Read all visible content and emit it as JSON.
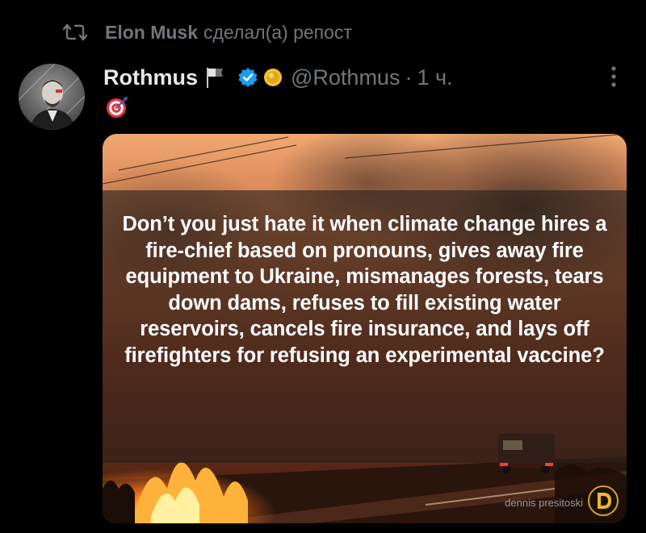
{
  "repost": {
    "name": "Elon Musk",
    "action": "сделал(а) репост"
  },
  "post": {
    "author_name": "Rothmus",
    "handle": "@Rothmus",
    "separator": "·",
    "timestamp": "1 ч.",
    "emoji": "🎯",
    "image_text": "Don’t you just hate it when climate change hires a fire-chief based on pronouns, gives away fire equipment to Ukraine, mismanages forests, tears down dams, refuses to fill existing water reservoirs, cancels fire insurance, and lays off firefighters for refusing an experimental vaccine?",
    "watermark": "dennis presitoski"
  },
  "icons": {
    "repost": "repost-icon",
    "flag": "flag-icon",
    "verified": "verified-badge-icon",
    "coin": "coin-icon",
    "more": "more-vertical-icon",
    "watermark_logo": "d-logo-icon"
  },
  "colors": {
    "background": "#000000",
    "text_primary": "#e7e9ea",
    "text_secondary": "#71767b",
    "verified_blue": "#1d9bf0"
  }
}
